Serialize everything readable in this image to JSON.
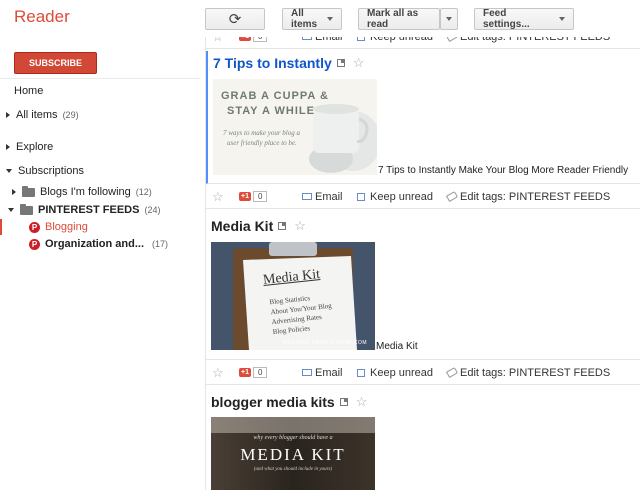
{
  "app": {
    "logo": "Reader"
  },
  "toolbar": {
    "refresh_glyph": "⟳",
    "all_items": "All items",
    "mark_all": "Mark all as read",
    "feed_settings": "Feed settings..."
  },
  "sidebar": {
    "subscribe": "SUBSCRIBE",
    "home": "Home",
    "all_items": {
      "label": "All items",
      "count": "(29)"
    },
    "explore": "Explore",
    "subscriptions": "Subscriptions",
    "folders": [
      {
        "label": "Blogs I'm following",
        "count": "(12)"
      },
      {
        "label": "PINTEREST FEEDS",
        "count": "(24)"
      }
    ],
    "feeds": [
      {
        "label": "Blogging",
        "count": ""
      },
      {
        "label": "Organization and...",
        "count": "(17)"
      }
    ]
  },
  "actions": {
    "gplus": "+1",
    "gplus_count": "0",
    "email": "Email",
    "keep_unread": "Keep unread",
    "edit_tags": "Edit tags:",
    "tag_name": "PINTEREST FEEDS"
  },
  "items": [
    {
      "title": "7 Tips to Instantly",
      "snippet": "7 Tips to Instantly Make Your Blog More Reader Friendly",
      "thumb_line1": "GRAB A CUPPA &",
      "thumb_line2": "STAY A WHILE",
      "thumb_line3": "7 ways to make your blog a",
      "thumb_line4": "user friendly place to be."
    },
    {
      "title": "Media Kit",
      "snippet": "Media Kit",
      "thumb_title": "Media Kit",
      "thumb_lines": [
        "Blog Statistics",
        "About You/Your Blog",
        "Advertising Rates",
        "Blog Policies"
      ],
      "thumb_footer": "MUSINGS FROM A SAHM.COM"
    },
    {
      "title": "blogger media kits",
      "thumb_line1": "why every blogger should have a",
      "thumb_big": "MEDIA KIT",
      "thumb_line2": "(and what you should include in yours)"
    }
  ],
  "colors": {
    "accent": "#dd4b39",
    "link": "#1155cc",
    "selected": "#4d90fe"
  }
}
